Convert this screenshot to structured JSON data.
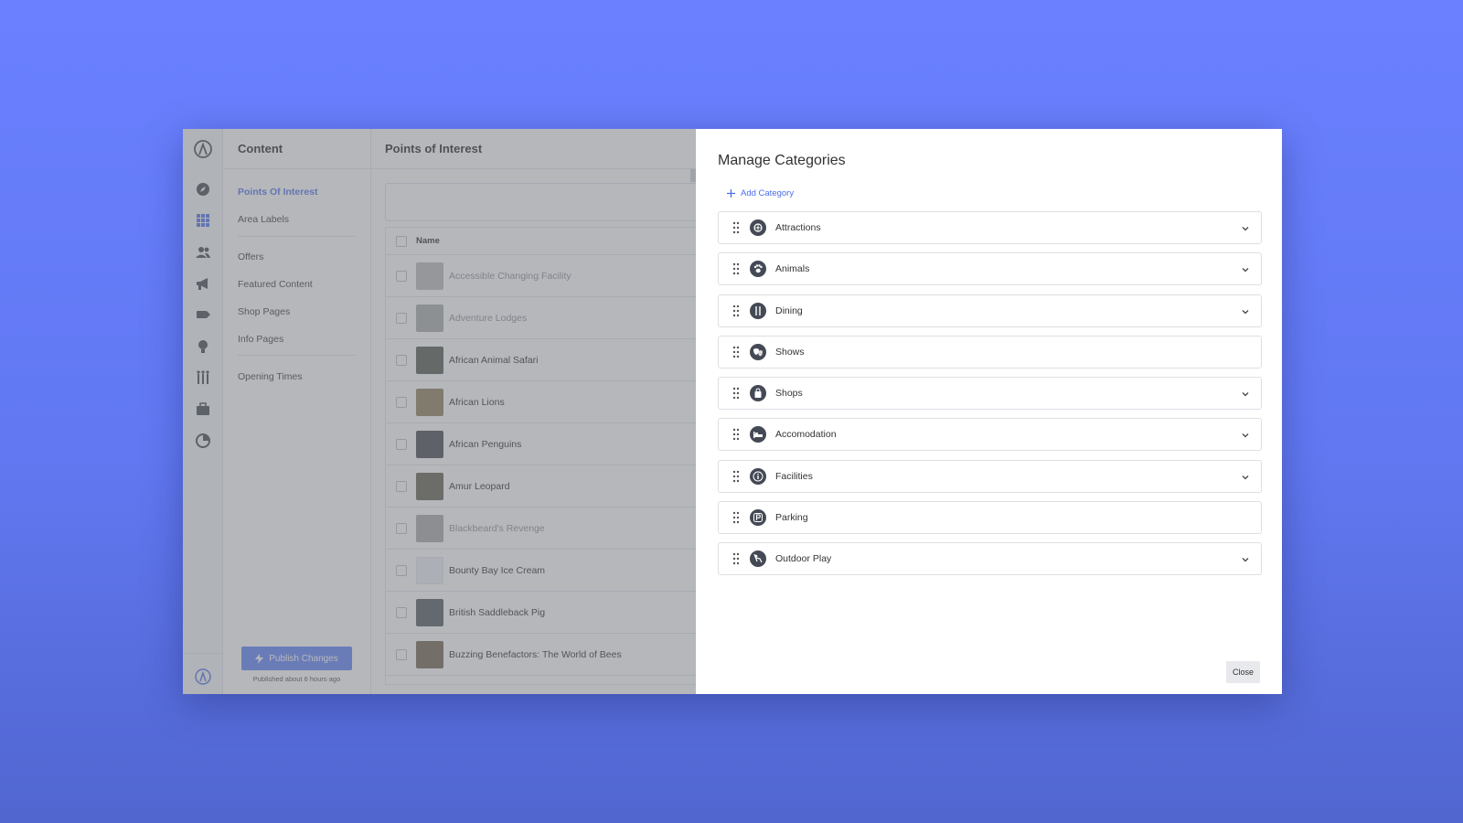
{
  "sidebar": {
    "title": "Content",
    "items": [
      {
        "label": "Points Of Interest",
        "active": true
      },
      {
        "label": "Area Labels"
      },
      {
        "label": "Offers"
      },
      {
        "label": "Featured Content"
      },
      {
        "label": "Shop Pages"
      },
      {
        "label": "Info Pages"
      },
      {
        "label": "Opening Times"
      }
    ],
    "publish_label": "Publish Changes",
    "published_status": "Published about 6 hours ago"
  },
  "rail_icons": [
    "compass-icon",
    "grid-icon",
    "users-icon",
    "megaphone-icon",
    "tag-icon",
    "lightbulb-icon",
    "queue-icon",
    "briefcase-icon",
    "chart-icon"
  ],
  "poi": {
    "title": "Points of Interest",
    "column_name": "Name",
    "rows": [
      {
        "name": "Accessible Changing Facility",
        "dim": true
      },
      {
        "name": "Adventure Lodges",
        "dim": true
      },
      {
        "name": "African Animal Safari"
      },
      {
        "name": "African Lions"
      },
      {
        "name": "African Penguins"
      },
      {
        "name": "Amur Leopard"
      },
      {
        "name": "Blackbeard's Revenge",
        "dim": true
      },
      {
        "name": "Bounty Bay Ice Cream"
      },
      {
        "name": "British Saddleback Pig"
      },
      {
        "name": "Buzzing Benefactors: The World of Bees"
      }
    ]
  },
  "modal": {
    "title": "Manage Categories",
    "add_label": "Add Category",
    "close_label": "Close",
    "categories": [
      {
        "label": "Attractions",
        "icon": "ferris-wheel-icon",
        "expandable": true
      },
      {
        "label": "Animals",
        "icon": "paw-icon",
        "expandable": true
      },
      {
        "label": "Dining",
        "icon": "cutlery-icon",
        "expandable": true
      },
      {
        "label": "Shows",
        "icon": "theatre-masks-icon",
        "expandable": false
      },
      {
        "label": "Shops",
        "icon": "shopping-bag-icon",
        "expandable": true
      },
      {
        "label": "Accomodation",
        "icon": "bed-icon",
        "expandable": true
      },
      {
        "label": "Facilities",
        "icon": "info-icon",
        "expandable": true
      },
      {
        "label": "Parking",
        "icon": "parking-icon",
        "expandable": false
      },
      {
        "label": "Outdoor Play",
        "icon": "swing-icon",
        "expandable": true
      }
    ]
  },
  "colors": {
    "accent": "#4a6ee8",
    "button": "#5a7cf5",
    "background": "#6a80ff"
  }
}
